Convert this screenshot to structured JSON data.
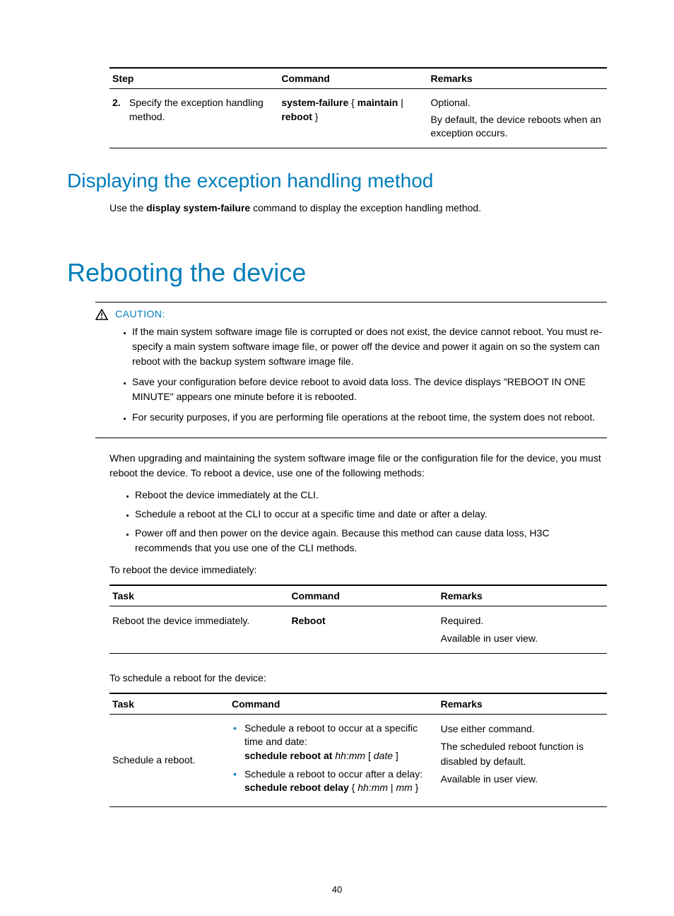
{
  "table1": {
    "headers": [
      "Step",
      "Command",
      "Remarks"
    ],
    "row": {
      "num": "2.",
      "step": "Specify the exception handling method.",
      "cmd_pre": "system-failure",
      "cmd_brace_open": " { ",
      "cmd_m": "maintain",
      "cmd_pipe": " | ",
      "cmd_r": "reboot",
      "cmd_brace_close": " }",
      "remarks1": "Optional.",
      "remarks2": "By default, the device reboots when an exception occurs."
    }
  },
  "h2_display": "Displaying the exception handling method",
  "p_display_1": "Use the ",
  "p_display_cmd": "display system-failure",
  "p_display_2": " command to display the exception handling method.",
  "h1_reboot": "Rebooting the device",
  "caution": {
    "label": "CAUTION:",
    "items": [
      "If the main system software image file is corrupted or does not exist, the device cannot reboot. You must re-specify a main system software image file, or power off the device and power it again on so the system can reboot with the backup system software image file.",
      "Save your configuration before device reboot to avoid data loss. The device displays \"REBOOT IN ONE MINUTE\" appears one minute before it is rebooted.",
      "For security purposes, if you are performing file operations at the reboot time, the system does not reboot."
    ]
  },
  "p_reboot_intro": "When upgrading and maintaining the system software image file or the configuration file for the device, you must reboot the device. To reboot a device, use one of the following methods:",
  "reboot_methods": [
    "Reboot the device immediately at the CLI.",
    "Schedule a reboot at the CLI to occur at a specific time and date or after a delay.",
    "Power off and then power on the device again. Because this method can cause data loss, H3C recommends that you use one of the CLI methods."
  ],
  "p_reboot_imm": "To reboot the device immediately:",
  "table2": {
    "headers": [
      "Task",
      "Command",
      "Remarks"
    ],
    "task": "Reboot the device immediately.",
    "cmd": "Reboot",
    "remarks1": "Required.",
    "remarks2": "Available in user view."
  },
  "p_reboot_sched": "To schedule a reboot for the device:",
  "table3": {
    "headers": [
      "Task",
      "Command",
      "Remarks"
    ],
    "task": "Schedule a reboot.",
    "cmd1_text": "Schedule a reboot to occur at a specific time and date:",
    "cmd1_b": "schedule reboot at",
    "cmd1_i1": "hh:mm",
    "cmd1_mid": " [ ",
    "cmd1_i2": "date",
    "cmd1_end": " ]",
    "cmd2_text": "Schedule a reboot to occur after a delay:",
    "cmd2_b": "schedule reboot delay",
    "cmd2_mid": " { ",
    "cmd2_i1": "hh:mm",
    "cmd2_pipe": " | ",
    "cmd2_i2": "mm",
    "cmd2_end": " }",
    "remarks1": "Use either command.",
    "remarks2": "The scheduled reboot function is disabled by default.",
    "remarks3": "Available in user view."
  },
  "page_number": "40"
}
